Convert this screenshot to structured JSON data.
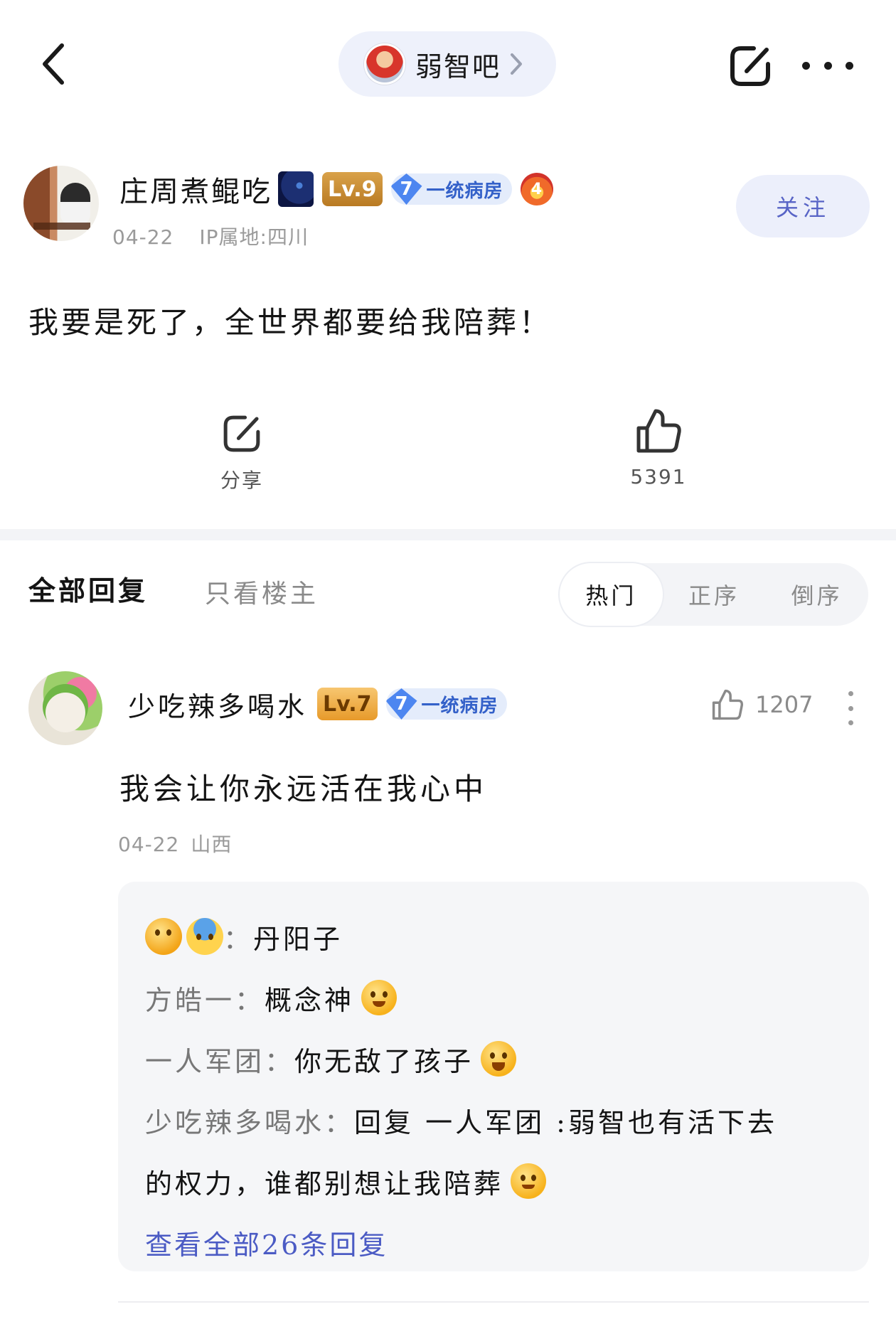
{
  "header": {
    "forum_name": "弱智吧"
  },
  "post": {
    "author": {
      "name": "庄周煮鲲吃",
      "level": "Lv.9",
      "rank_number": "7",
      "rank_title": "一统病房",
      "fire_badge": "4",
      "date": "04-22",
      "ip": "IP属地:四川"
    },
    "follow_label": "关注",
    "content": "我要是死了，全世界都要给我陪葬！",
    "share_label": "分享",
    "like_count": "5391"
  },
  "tabs": {
    "all": "全部回复",
    "op_only": "只看楼主",
    "sort": [
      "热门",
      "正序",
      "倒序"
    ],
    "active_sort": "热门"
  },
  "comment": {
    "name": "少吃辣多喝水",
    "level": "Lv.7",
    "rank_number": "7",
    "rank_title": "一统病房",
    "like_count": "1207",
    "content": "我会让你永远活在我心中",
    "date": "04-22",
    "location": "山西",
    "replies": [
      {
        "who": "：",
        "text": "丹阳子",
        "emoji_prefix": [
          "thinking-face",
          "screaming-face"
        ]
      },
      {
        "who": "方皓一：",
        "text": "概念神",
        "emoji_suffix": "shushing-face"
      },
      {
        "who": "一人军团：",
        "text": "你无敌了孩子",
        "emoji_suffix": "laughing-face"
      },
      {
        "who": "少吃辣多喝水：",
        "text": "回复 一人军团 :弱智也有活下去"
      },
      {
        "who": "",
        "text": "的权力，谁都别想让我陪葬",
        "emoji_suffix": "smiling-face"
      }
    ],
    "view_all": "查看全部26条回复"
  },
  "colors": {
    "accent": "#4b5bc4",
    "follow_bg": "#eceffb",
    "divider": "#f3f4f7",
    "secondary_text": "#9a9a9a"
  }
}
